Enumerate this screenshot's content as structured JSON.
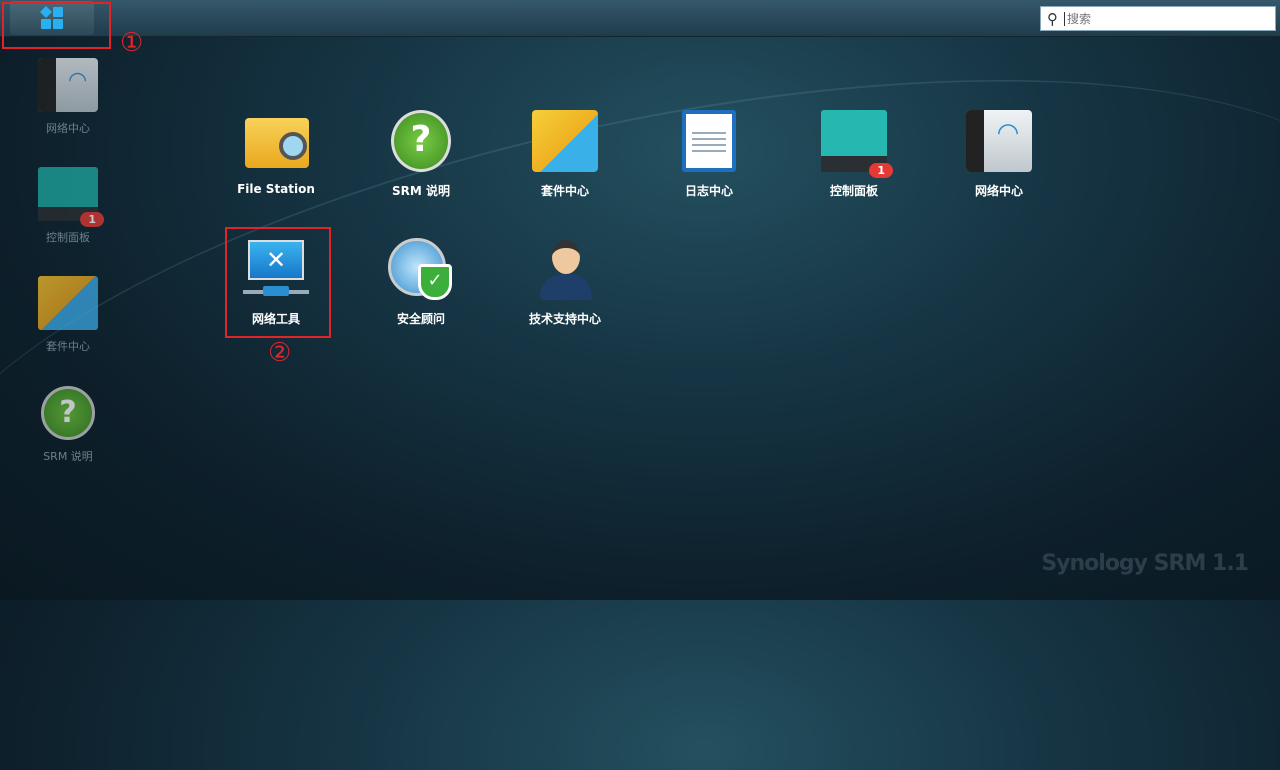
{
  "taskbar": {
    "search_placeholder": "搜索"
  },
  "apps": [
    {
      "label": "File Station",
      "icon": "folder-search-icon"
    },
    {
      "label": "SRM 说明",
      "icon": "help-icon"
    },
    {
      "label": "套件中心",
      "icon": "package-bag-icon"
    },
    {
      "label": "日志中心",
      "icon": "log-list-icon"
    },
    {
      "label": "控制面板",
      "icon": "control-panel-icon",
      "badge": "1"
    },
    {
      "label": "网络中心",
      "icon": "wifi-router-icon"
    },
    {
      "label": "网络工具",
      "icon": "network-tools-icon"
    },
    {
      "label": "安全顾问",
      "icon": "security-shield-icon"
    },
    {
      "label": "技术支持中心",
      "icon": "support-agent-icon"
    }
  ],
  "sidebar": [
    {
      "label": "网络中心"
    },
    {
      "label": "控制面板",
      "badge": "1"
    },
    {
      "label": "套件中心"
    },
    {
      "label": "SRM 说明"
    }
  ],
  "annotations": {
    "one": "①",
    "two": "②"
  },
  "brand": {
    "logo": "Synology SRM 1.1"
  },
  "colors": {
    "accent": "#2ab0f0",
    "annotation": "#e0242a"
  }
}
